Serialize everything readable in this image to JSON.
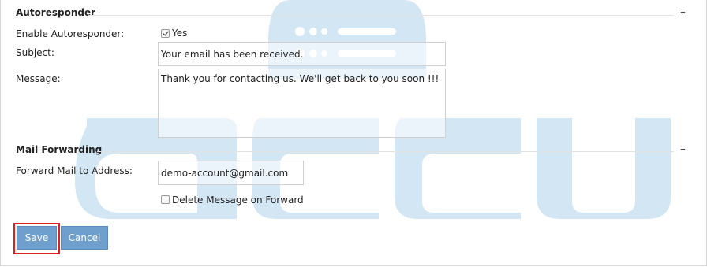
{
  "autoresponder": {
    "title": "Autoresponder",
    "collapse_symbol": "–",
    "enable_label": "Enable Autoresponder:",
    "enable_checked": true,
    "enable_value_label": "Yes",
    "subject_label": "Subject:",
    "subject_value": "Your email has been received.",
    "message_label": "Message:",
    "message_value": "Thank you for contacting us. We'll get back to you soon !!!"
  },
  "mail_forwarding": {
    "title": "Mail Forwarding",
    "collapse_symbol": "–",
    "forward_label": "Forward Mail to Address:",
    "forward_value": "demo-account@gmail.com",
    "delete_label": "Delete Message on Forward",
    "delete_checked": false
  },
  "actions": {
    "save_label": "Save",
    "cancel_label": "Cancel"
  },
  "colors": {
    "button_bg": "#6f9fcd",
    "highlight": "#e02020",
    "watermark": "#cfe3f2"
  },
  "watermark": {
    "text": "accu"
  }
}
